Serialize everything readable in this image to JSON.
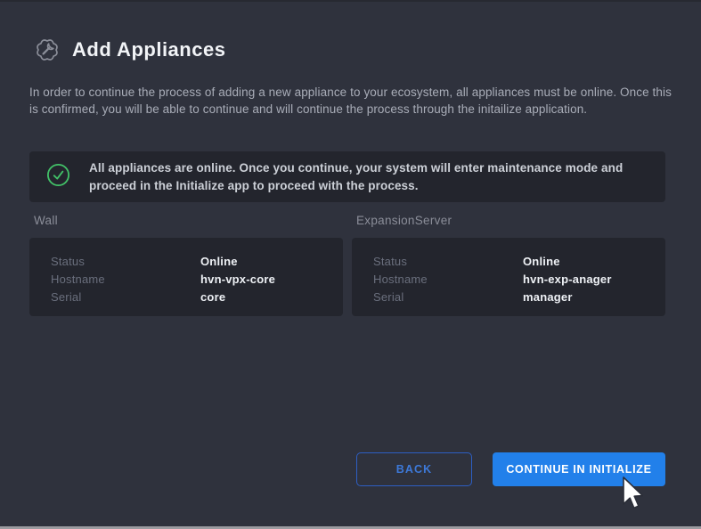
{
  "header": {
    "title": "Add Appliances",
    "icon": "gear-wrench-icon"
  },
  "intro": {
    "text": "In order to continue the process of adding a new appliance to your ecosystem, all appliances must be online. Once this is confirmed, you will be able to continue and will continue the process through the initailize application."
  },
  "banner": {
    "icon": "check-circle-icon",
    "text": "All appliances are online. Once you continue, your system will enter maintenance mode and proceed in the Initialize app to proceed with the process."
  },
  "appliances": [
    {
      "name": "Wall",
      "fields": [
        {
          "label": "Status",
          "value": "Online"
        },
        {
          "label": "Hostname",
          "value": "hvn-vpx-core"
        },
        {
          "label": "Serial",
          "value": "core"
        }
      ]
    },
    {
      "name": "ExpansionServer",
      "fields": [
        {
          "label": "Status",
          "value": "Online"
        },
        {
          "label": "Hostname",
          "value": "hvn-exp-anager"
        },
        {
          "label": "Serial",
          "value": "manager"
        }
      ]
    }
  ],
  "footer": {
    "back_label": "BACK",
    "continue_label": "CONTINUE IN INITIALIZE"
  },
  "colors": {
    "page_background": "#2F323D",
    "panel_background": "#23252D",
    "accent_blue": "#2280EA",
    "back_border_blue": "#2D5FC4",
    "success_green": "#42C268",
    "value_text": "#EEF1F5",
    "muted_text": "#6A6F7D"
  }
}
